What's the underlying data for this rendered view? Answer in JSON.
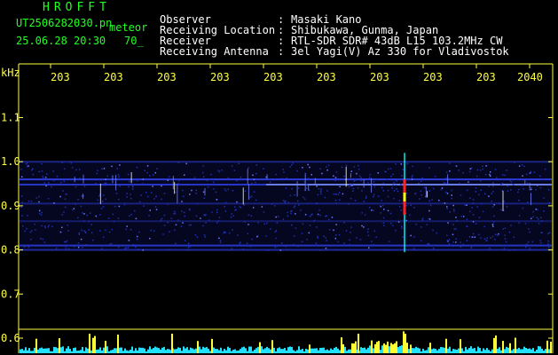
{
  "header": {
    "brand": "HROFFT",
    "filename": "UT2506282030.pn",
    "mode": "meteor",
    "datetime": "25.06.28 20:30",
    "count": "70_"
  },
  "meta": [
    {
      "key": "Observer",
      "value": "Masaki Kano"
    },
    {
      "key": "Receiving Location",
      "value": "Shibukawa, Gunma, Japan"
    },
    {
      "key": "Receiver",
      "value": "RTL-SDR SDR# 43dB L15 103.2MHz CW"
    },
    {
      "key": "Receiving Antenna",
      "value": "3el Yagi(V) Az 330 for Vladivostok"
    }
  ],
  "chart_data": {
    "type": "heatmap",
    "ylabel": "kHz",
    "x_ticks": [
      "203",
      "203",
      "203",
      "203",
      "203",
      "203",
      "203",
      "203",
      "203",
      "2040"
    ],
    "y_ticks": [
      "1.1",
      "1.0",
      "0.9",
      "0.8",
      "0.7",
      "0.6"
    ],
    "y_values": [
      1.1,
      1.0,
      0.9,
      0.8,
      0.7,
      0.6
    ],
    "ylim": [
      0.59,
      1.13
    ],
    "colors": {
      "axis": "#ffff44",
      "band": "#2b3bd8",
      "meteor": "#ff2222",
      "signal": "#ffffff",
      "echo": "#00ffff"
    }
  }
}
